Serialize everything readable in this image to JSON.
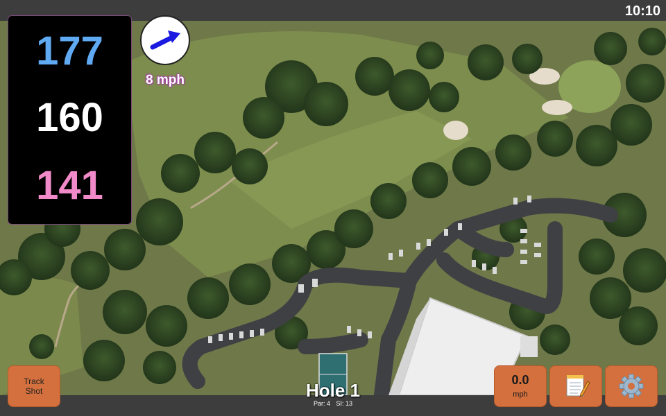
{
  "status_bar": {
    "time": "10:10"
  },
  "distances": {
    "back": "177",
    "middle": "160",
    "front": "141"
  },
  "wind": {
    "speed": "8 mph",
    "icon": "wind-direction-arrow-icon"
  },
  "buttons": {
    "track_shot_line1": "Track",
    "track_shot_line2": "Shot",
    "speed_value": "0.0",
    "speed_unit": "mph",
    "notes_icon": "notepad-icon",
    "settings_icon": "gear-icon"
  },
  "hole": {
    "title": "Hole 1",
    "par": "Par: 4",
    "si": "SI: 13"
  },
  "colors": {
    "back_distance": "#5faaf2",
    "middle_distance": "#ffffff",
    "front_distance": "#f08ac8",
    "button": "#d3703d",
    "wind_text_glow": "#a040a0"
  }
}
